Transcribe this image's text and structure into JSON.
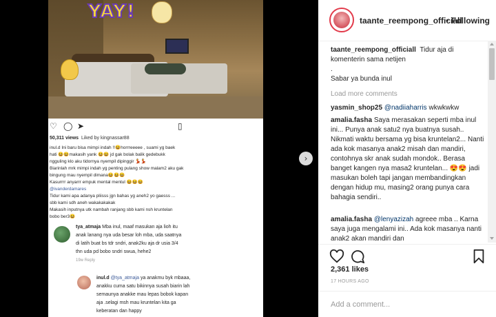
{
  "post": {
    "views": "50,311 views",
    "liked_by": "Liked by kingnassar88",
    "inner_caption": [
      "inul.d Ini baru bisa mimpi indah !!😆horrreeeee , suami yg baek",
      "hati 😆😆makasih yank 😆😆 jd gak bolak balik gedebukk",
      "ngguling klo aku tidornya nyempil dipinggir 💃💃",
      "Biarinlah mrk mimpi indah yg penting pulang show malam2 aku gak",
      "bingung mau nyempil dimana😆😆😆",
      "Kasurrrr anyarrr empuk mental mentul 😆😆😆"
    ],
    "inner_mention": "@ivanderdamares",
    "inner_caption2": [
      "Tidur kami apa adanya pliisss jgn bahas yg aneh2 yo gaesss ...",
      "sbb kami sdh aneh wakakakakak",
      "Makasih inputnya utk nambah ranjang sbb kami nsh kruntelan",
      "bobo ber3😆"
    ],
    "inner_comment1": {
      "user": "tya_atmaja",
      "lines": [
        "Mba inul,  maaf masukan aja lioh  itu",
        "anak lanang nya uda besar loh mba,  uda saatnya",
        "di latih buat bs tdr sndri,  anak2ku aja dr usia 3/4",
        "thn uda pd bobo sndri swua,  hehe2"
      ],
      "meta": "19w    Reply"
    },
    "inner_comment2": {
      "user": "inul.d",
      "mention": "@tya_atmaja",
      "lines": [
        "ya anakmu byk mbaaa,",
        "anakku cuma satu bikinnya susah biarin lah",
        "semaunya anakke mau lepas bobok kapan",
        "aja .selagi msh mau kruntelan kita ga",
        "keberatan dan happy"
      ]
    },
    "yay_text": "YAY!"
  },
  "header": {
    "username": "taante_reempong_officiall",
    "dot": "•",
    "follow_label": "Following"
  },
  "caption": {
    "user": "taante_reempong_officiall",
    "text": "Tidur aja di komenterin sama netijen",
    "dot": ".",
    "text2": "Sabar ya bunda inul"
  },
  "load_more": "Load more comments",
  "comments": [
    {
      "user": "yasmin_shop25",
      "mention": "@nadiiaharris",
      "text": " wkwkwkw"
    },
    {
      "user": "amalia.fasha",
      "mention": "",
      "text": " Saya merasakan seperti mba inul ini... Punya anak satu2 nya buatnya susah.. Nikmati waktu bersama yg bisa kruntelan2... Nanti ada kok masanya anak2 misah dan mandiri, contohnya skr anak sudah mondok.. Berasa banget kangen nya masa2 kruntelan... 😍😍 jadi masukan boleh tapi jangan membandingkan dengan hidup mu, masing2 orang punya cara bahagia sendiri.."
    },
    {
      "user": "amalia.fasha",
      "mention": "@lenyazizah",
      "text": " agreee mba .. Karna saya juga mengalami ini.. Ada kok masanya nanti anak2 akan mandiri dan"
    }
  ],
  "likes": "2,361 likes",
  "time": "17 HOURS AGO",
  "add_comment_placeholder": "Add a comment...",
  "next_arrow": "›",
  "colors": {
    "accent_link": "#003569",
    "avatar_ring": "#e23a4a"
  }
}
